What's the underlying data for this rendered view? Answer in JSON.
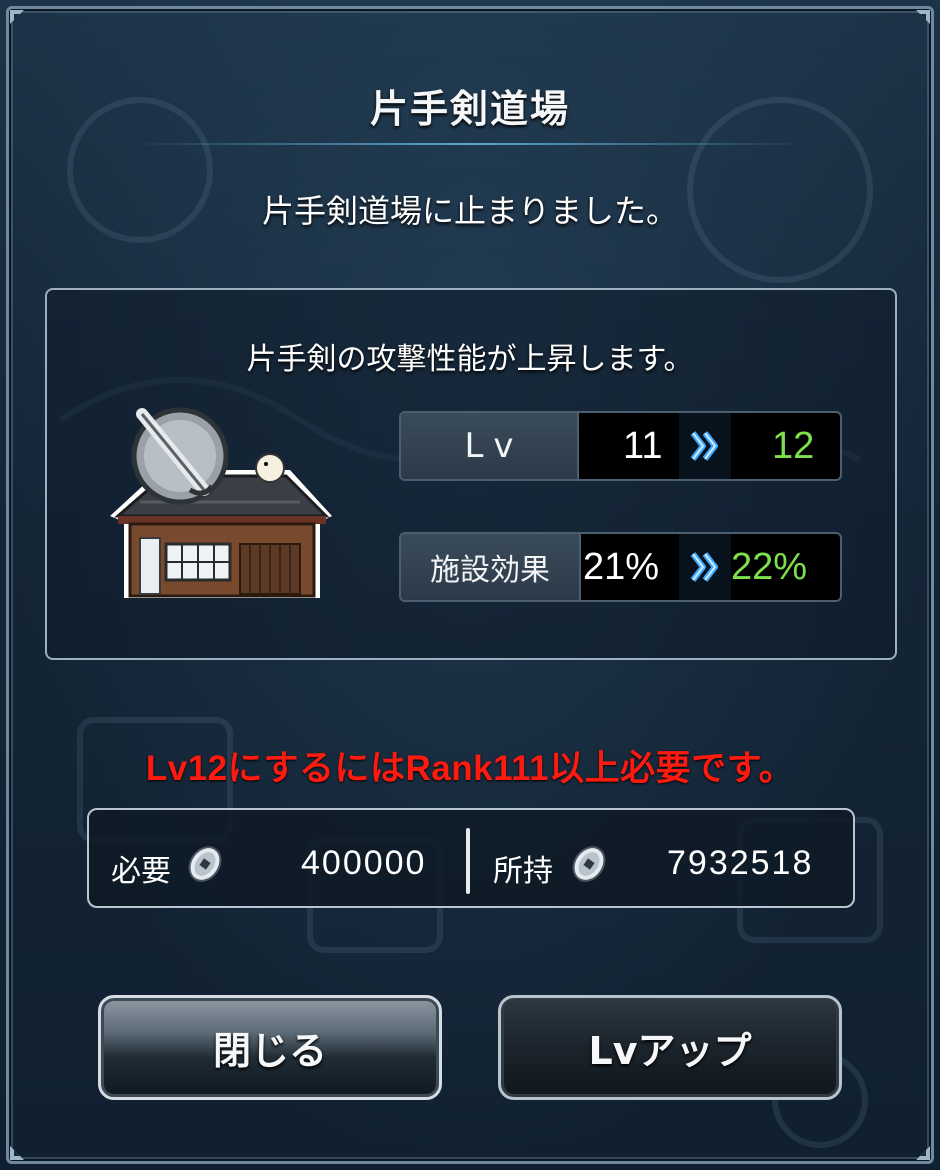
{
  "dialog": {
    "title": "片手剣道場",
    "message": "片手剣道場に止まりました。",
    "effect_description": "片手剣の攻撃性能が上昇します。"
  },
  "stats": {
    "level": {
      "label": "Lv",
      "current": "11",
      "next": "12"
    },
    "facility_effect": {
      "label": "施設効果",
      "current": "21%",
      "next": "22%"
    }
  },
  "warning": "Lv12にするにはRank111以上必要です。",
  "cost": {
    "required_label": "必要",
    "required_value": "400000",
    "owned_label": "所持",
    "owned_value": "7932518",
    "currency_icon": "coin-icon"
  },
  "buttons": {
    "close_label": "閉じる",
    "levelup_label": "Lvアップ"
  },
  "colors": {
    "next_value": "#7ee04c",
    "warning": "#ff1a10",
    "arrow": "#3aa8ff"
  }
}
